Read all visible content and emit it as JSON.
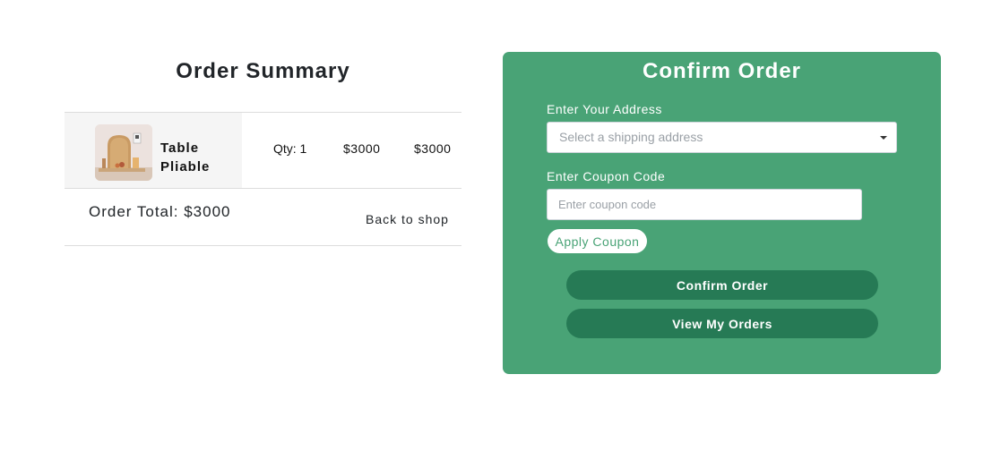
{
  "summary": {
    "title": "Order Summary",
    "item": {
      "name": "Table Pliable",
      "qty": "Qty: 1",
      "price": "$3000",
      "subtotal": "$3000"
    },
    "order_total": "Order Total: $3000",
    "back_link": "Back to shop"
  },
  "confirm": {
    "title": "Confirm Order",
    "address_label": "Enter Your Address",
    "address_placeholder": "Select a shipping address",
    "coupon_label": "Enter Coupon Code",
    "coupon_placeholder": "Enter coupon code",
    "apply_label": "Apply Coupon",
    "confirm_label": "Confirm Order",
    "view_orders_label": "View My Orders"
  },
  "colors": {
    "panel": "#49a376",
    "button_dark": "#267a55",
    "text": "#212529"
  }
}
